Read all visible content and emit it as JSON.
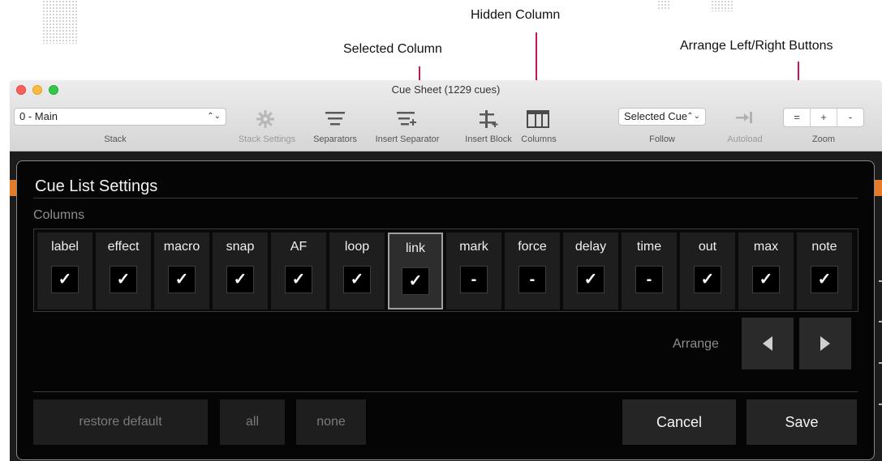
{
  "annotations": {
    "selected_column": "Selected Column",
    "hidden_column": "Hidden Column",
    "arrange_buttons": "Arrange Left/Right Buttons",
    "line_color": "#c2185b"
  },
  "window": {
    "title": "Cue Sheet (1229 cues)"
  },
  "toolbar": {
    "stack_value": "0 - Main",
    "stack_label": "Stack",
    "stack_settings_label": "Stack Settings",
    "separators_label": "Separators",
    "insert_separator_label": "Insert Separator",
    "insert_block_label": "Insert Block",
    "columns_label": "Columns",
    "follow_value": "Selected Cue",
    "follow_label": "Follow",
    "autoload_label": "Autoload",
    "zoom_label": "Zoom",
    "zoom_buttons": [
      "=",
      "+",
      "-"
    ]
  },
  "dialog": {
    "title": "Cue List Settings",
    "columns_section": "Columns",
    "columns": [
      {
        "name": "label",
        "state": "✓"
      },
      {
        "name": "effect",
        "state": "✓"
      },
      {
        "name": "macro",
        "state": "✓"
      },
      {
        "name": "snap",
        "state": "✓"
      },
      {
        "name": "AF",
        "state": "✓"
      },
      {
        "name": "loop",
        "state": "✓"
      },
      {
        "name": "link",
        "state": "✓"
      },
      {
        "name": "mark",
        "state": "-"
      },
      {
        "name": "force",
        "state": "-"
      },
      {
        "name": "delay",
        "state": "✓"
      },
      {
        "name": "time",
        "state": "-"
      },
      {
        "name": "out",
        "state": "✓"
      },
      {
        "name": "max",
        "state": "✓"
      },
      {
        "name": "note",
        "state": "✓"
      }
    ],
    "arrange_label": "Arrange",
    "buttons": {
      "restore_default": "restore default",
      "all": "all",
      "none": "none",
      "cancel": "Cancel",
      "save": "Save"
    }
  },
  "colors": {
    "accent_orange": "#e57a2a",
    "dialog_bg": "#050505"
  }
}
